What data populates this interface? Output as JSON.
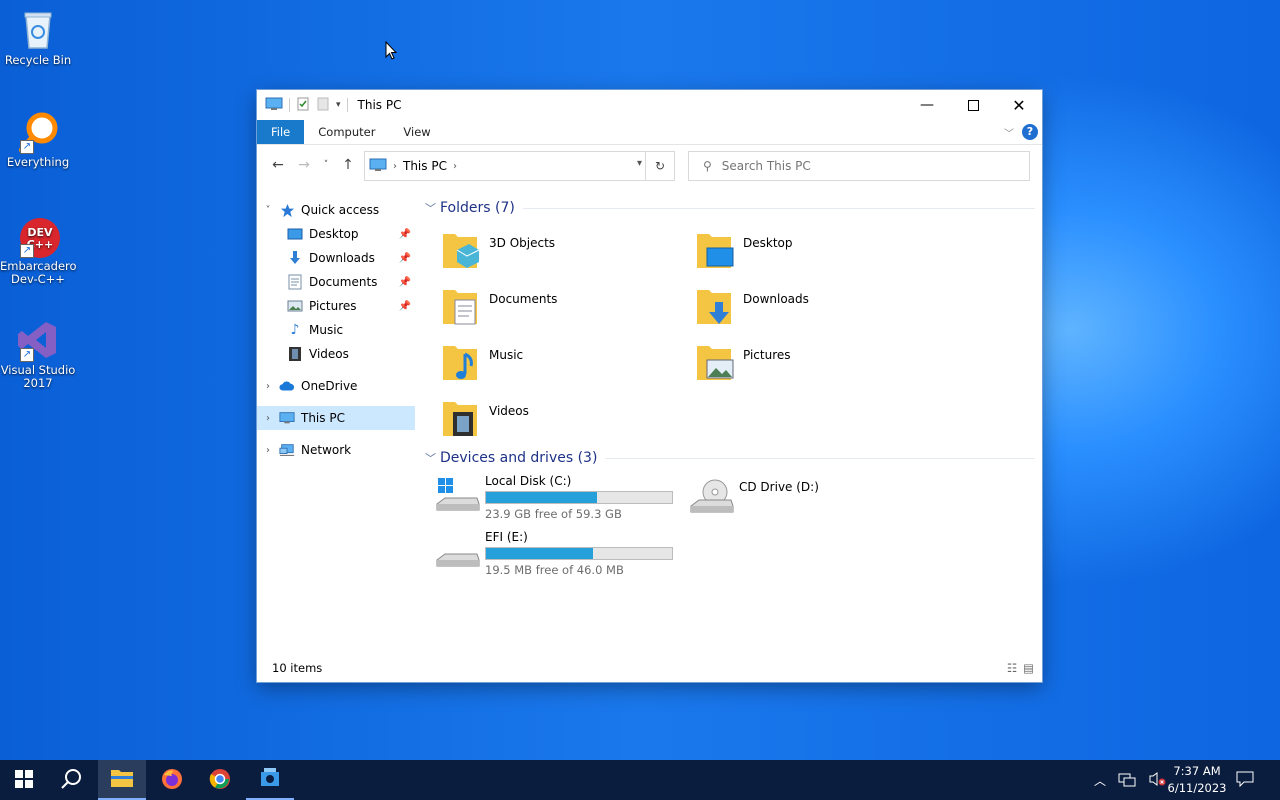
{
  "desktop": {
    "icons": [
      {
        "label": "Recycle Bin"
      },
      {
        "label": "Everything"
      },
      {
        "label": "Embarcadero Dev-C++"
      },
      {
        "label": "Visual Studio 2017"
      }
    ]
  },
  "window": {
    "title": "This PC",
    "ribbon_tabs": [
      "File",
      "Computer",
      "View"
    ],
    "address_crumb": "This PC",
    "search_placeholder": "Search This PC"
  },
  "nav_pane": {
    "quick_access": "Quick access",
    "quick_items": [
      "Desktop",
      "Downloads",
      "Documents",
      "Pictures",
      "Music",
      "Videos"
    ],
    "onedrive": "OneDrive",
    "this_pc": "This PC",
    "network": "Network"
  },
  "content": {
    "folders_header": "Folders (7)",
    "folders": [
      "3D Objects",
      "Desktop",
      "Documents",
      "Downloads",
      "Music",
      "Pictures",
      "Videos"
    ],
    "drives_header": "Devices and drives (3)",
    "drives": [
      {
        "name": "Local Disk (C:)",
        "free": "23.9 GB free of 59.3 GB",
        "used_fraction": 0.597
      },
      {
        "name": "CD Drive (D:)"
      },
      {
        "name": "EFI (E:)",
        "free": "19.5 MB free of 46.0 MB",
        "used_fraction": 0.576
      }
    ]
  },
  "status": {
    "items": "10 items"
  },
  "taskbar": {
    "time": "7:37 AM",
    "date": "6/11/2023"
  },
  "colors": {
    "accent": "#1979ca",
    "selection": "#cce8ff",
    "drive_bar": "#26a0da",
    "folder": "#f4c542"
  }
}
